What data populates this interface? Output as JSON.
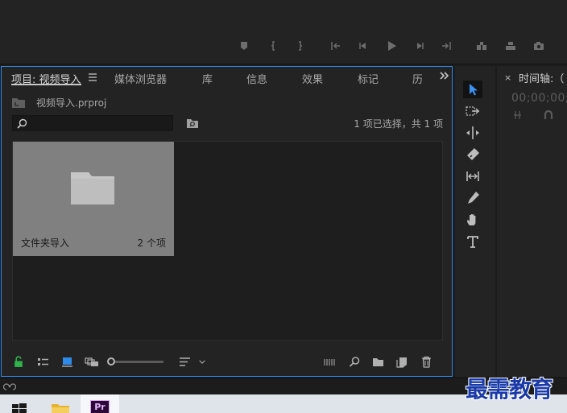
{
  "project_panel": {
    "tabs": [
      {
        "label": "项目: 视频导入",
        "active": true
      },
      {
        "label": "媒体浏览器"
      },
      {
        "label": "库"
      },
      {
        "label": "信息"
      },
      {
        "label": "效果"
      },
      {
        "label": "标记"
      },
      {
        "label": "历"
      }
    ],
    "project_file": "视频导入.prproj",
    "search": {
      "value": "",
      "placeholder": ""
    },
    "selection_status": "1 项已选择，共 1 项",
    "bins": [
      {
        "name": "文件夹导入",
        "count": "2 个项"
      }
    ]
  },
  "timeline_panel": {
    "title": "时间轴:（",
    "timecode": "00;00;00;"
  },
  "watermark": "最需教育",
  "taskbar": {
    "premiere_label": "Pr"
  },
  "colors": {
    "panel_bg": "#232323",
    "focus_border": "#2d8ceb",
    "active_tool": "#3b8ff0",
    "bin_card": "#808080",
    "lock_green": "#2fb34a",
    "icon_view_blue": "#2d8ceb",
    "watermark": "#1a3aa8"
  },
  "icons": {
    "tools": [
      "selection-tool-icon",
      "track-select-icon",
      "ripple-edit-icon",
      "razor-icon",
      "slip-icon",
      "pen-icon",
      "hand-icon",
      "type-icon"
    ],
    "project_bottom": [
      "lock-icon",
      "list-view-icon",
      "icon-view-icon",
      "freeform-view-icon",
      "zoom-slider",
      "sort-icon",
      "automate-icon",
      "find-icon",
      "new-bin-icon",
      "new-item-icon",
      "trash-icon"
    ]
  }
}
